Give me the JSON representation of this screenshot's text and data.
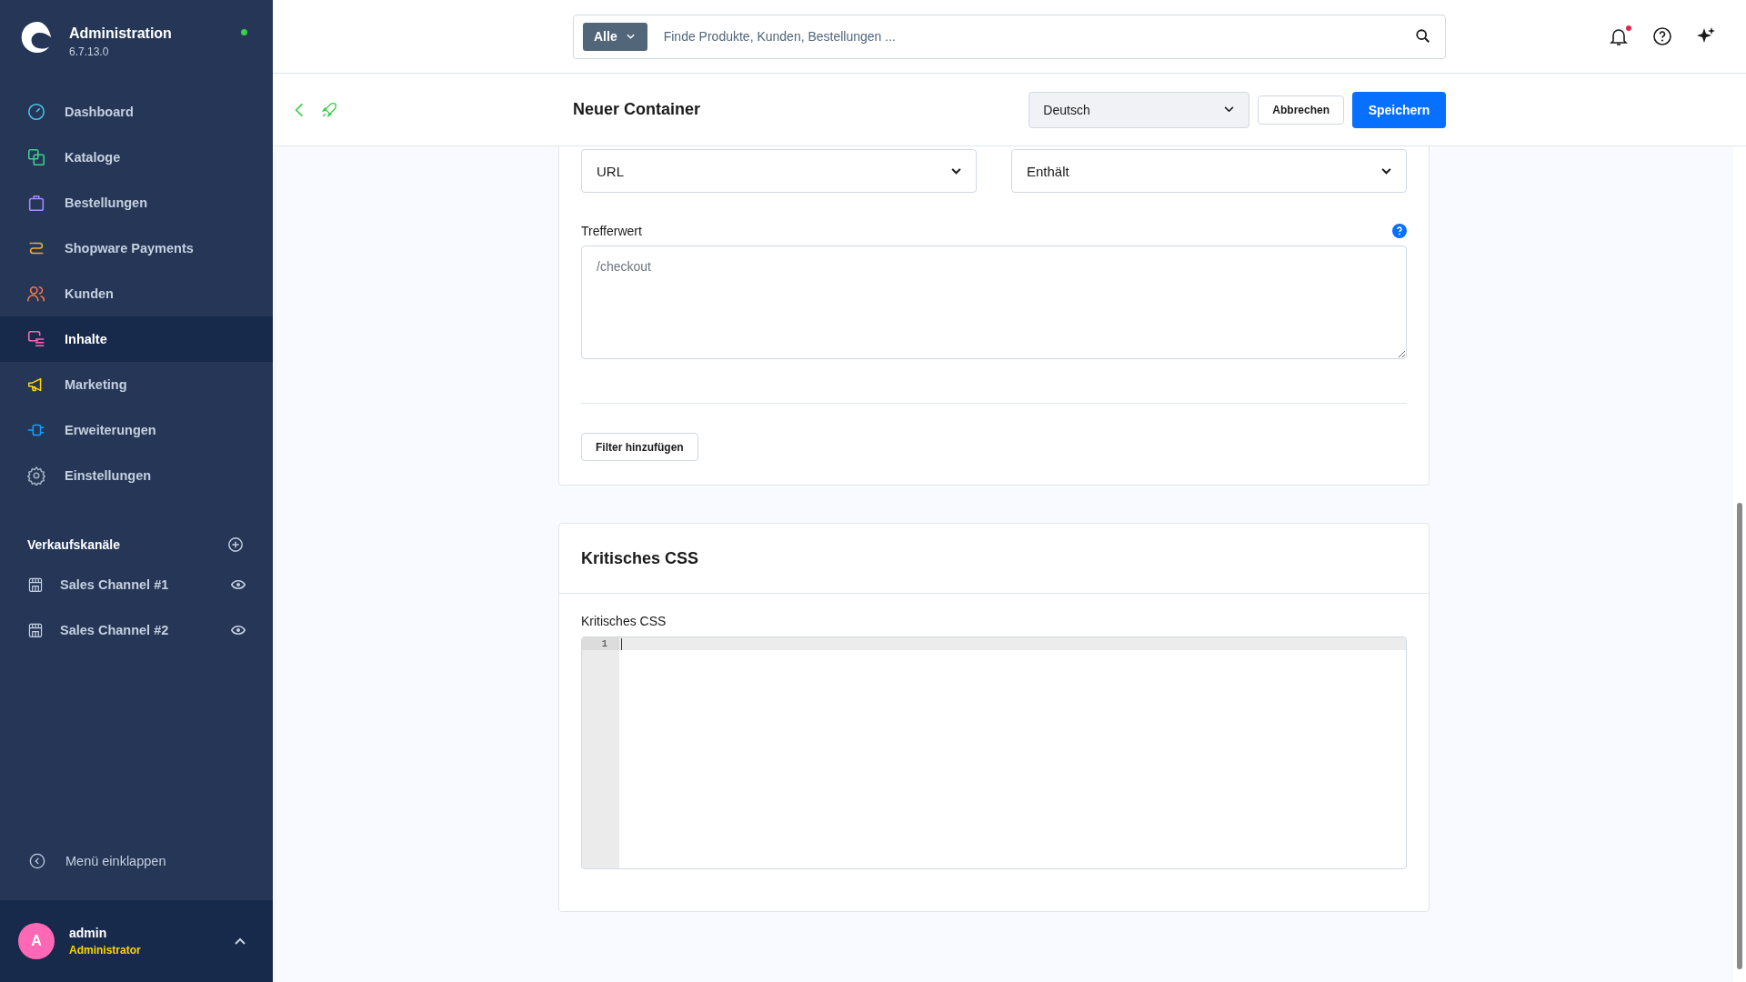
{
  "sidebar": {
    "brand": {
      "title": "Administration",
      "version": "6.7.13.0",
      "online": true
    },
    "items": [
      {
        "label": "Dashboard",
        "kind": "dashboard",
        "color": "#4fc3e8",
        "selected": false
      },
      {
        "label": "Kataloge",
        "kind": "catalog",
        "color": "#3ecf8e",
        "selected": false
      },
      {
        "label": "Bestellungen",
        "kind": "orders",
        "color": "#a78bfa",
        "selected": false
      },
      {
        "label": "Shopware Payments",
        "kind": "payments",
        "color": "#f6ad37",
        "selected": false
      },
      {
        "label": "Kunden",
        "kind": "customers",
        "color": "#ff7a45",
        "selected": false
      },
      {
        "label": "Inhalte",
        "kind": "content",
        "color": "#ff68b4",
        "selected": true
      },
      {
        "label": "Marketing",
        "kind": "marketing",
        "color": "#ffd500",
        "selected": false
      },
      {
        "label": "Erweiterungen",
        "kind": "extensions",
        "color": "#189eff",
        "selected": false
      },
      {
        "label": "Einstellungen",
        "kind": "settings",
        "color": "#a0aec0",
        "selected": false
      }
    ],
    "sales_channels": {
      "title": "Verkaufskanäle",
      "items": [
        {
          "label": "Sales Channel #1"
        },
        {
          "label": "Sales Channel #2"
        }
      ]
    },
    "collapse": "Menü einklappen",
    "user": {
      "initial": "A",
      "name": "admin",
      "role": "Administrator"
    }
  },
  "search": {
    "scope": "Alle",
    "placeholder": "Finde Produkte, Kunden, Bestellungen ..."
  },
  "notifications": {
    "unread": true
  },
  "page": {
    "title": "Neuer Container",
    "language": "Deutsch",
    "buttons": [
      {
        "label": "Abbrechen",
        "kind": "secondary"
      },
      {
        "label": "Speichern",
        "kind": "primary"
      }
    ]
  },
  "filter_card": {
    "selects": [
      "URL",
      "Enthält"
    ],
    "match": {
      "label": "Trefferwert",
      "placeholder": "/checkout"
    },
    "add_button": "Filter hinzufügen"
  },
  "css_card": {
    "title": "Kritisches CSS",
    "label": "Kritisches CSS",
    "line_numbers": [
      "1"
    ]
  }
}
